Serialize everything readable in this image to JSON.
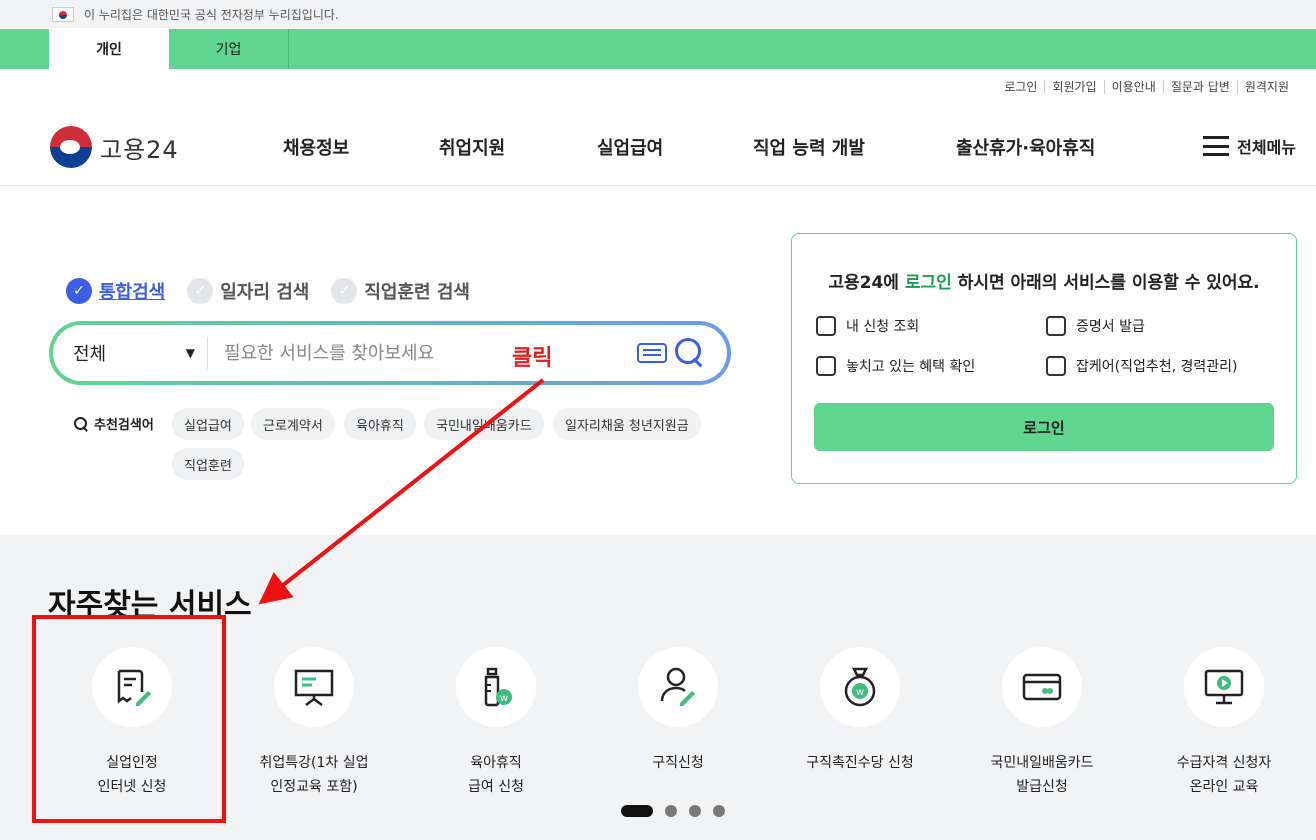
{
  "gov_banner": {
    "text": "이 누리집은 대한민국 공식 전자정부 누리집입니다."
  },
  "user_tabs": [
    {
      "label": "개인"
    },
    {
      "label": "기업"
    }
  ],
  "util_links": [
    {
      "label": "로그인"
    },
    {
      "label": "회원가입"
    },
    {
      "label": "이용안내"
    },
    {
      "label": "질문과 답변"
    },
    {
      "label": "원격지원"
    }
  ],
  "logo": {
    "text": "고용24"
  },
  "gnb": [
    {
      "label": "채용정보"
    },
    {
      "label": "취업지원"
    },
    {
      "label": "실업급여"
    },
    {
      "label": "직업 능력 개발"
    },
    {
      "label": "출산휴가·육아휴직"
    }
  ],
  "all_menu": {
    "label": "전체메뉴"
  },
  "search_types": [
    {
      "label": "통합검색",
      "selected": true
    },
    {
      "label": "일자리 검색",
      "selected": false
    },
    {
      "label": "직업훈련 검색",
      "selected": false
    }
  ],
  "search": {
    "scope": "전체",
    "placeholder": "필요한 서비스를 찾아보세요"
  },
  "annotation": {
    "click_label": "클릭"
  },
  "recommend": {
    "title": "추천검색어",
    "keywords": [
      "실업급여",
      "근로계약서",
      "육아휴직",
      "국민내일배움카드",
      "일자리채움 청년지원금",
      "직업훈련"
    ]
  },
  "login_panel": {
    "msg_prefix": "고용24에",
    "msg_highlight": "로그인",
    "msg_suffix": "하시면 아래의 서비스를 이용할 수 있어요.",
    "items": [
      {
        "label": "내 신청 조회"
      },
      {
        "label": "증명서 발급"
      },
      {
        "label": "놓치고 있는 혜택 확인"
      },
      {
        "label": "잡케어(직업추천, 경력관리)"
      }
    ],
    "button": "로그인"
  },
  "frequent": {
    "title": "자주찾는 서비스",
    "services": [
      {
        "line1": "실업인정",
        "line2": "인터넷 신청",
        "icon": "document-edit-icon"
      },
      {
        "line1": "취업특강(1차 실업",
        "line2": "인정교육 포함)",
        "icon": "presentation-board-icon"
      },
      {
        "line1": "육아휴직",
        "line2": "급여 신청",
        "icon": "baby-bottle-icon"
      },
      {
        "line1": "구직신청",
        "line2": "",
        "icon": "person-edit-icon"
      },
      {
        "line1": "구직촉진수당 신청",
        "line2": "",
        "icon": "money-bag-icon"
      },
      {
        "line1": "국민내일배움카드",
        "line2": "발급신청",
        "icon": "card-icon"
      },
      {
        "line1": "수급자격 신청자",
        "line2": "온라인 교육",
        "icon": "monitor-play-icon"
      }
    ],
    "carousel": {
      "current_page": 1,
      "total_pages": 4
    }
  }
}
